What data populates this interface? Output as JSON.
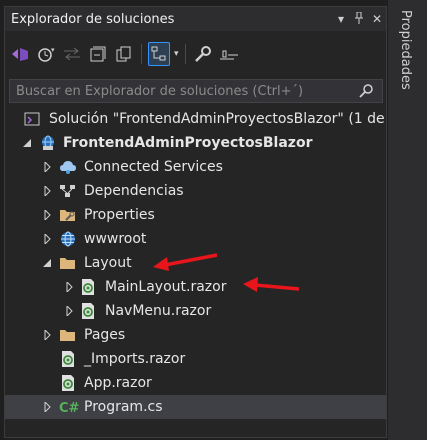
{
  "window": {
    "title": "Explorador de soluciones",
    "side_tab": "Propiedades"
  },
  "search": {
    "placeholder": "Buscar en Explorador de soluciones (Ctrl+´)"
  },
  "tree": {
    "solution": "Solución \"FrontendAdminProyectosBlazor\"  (1 de 1",
    "project": "FrontendAdminProyectosBlazor",
    "items": [
      {
        "label": "Connected Services",
        "icon": "connected-services-icon"
      },
      {
        "label": "Dependencias",
        "icon": "dependencies-icon"
      },
      {
        "label": "Properties",
        "icon": "properties-folder-icon"
      },
      {
        "label": "wwwroot",
        "icon": "globe-icon"
      },
      {
        "label": "Layout",
        "icon": "folder-icon"
      },
      {
        "label": "MainLayout.razor",
        "icon": "razor-file-icon"
      },
      {
        "label": "NavMenu.razor",
        "icon": "razor-file-icon"
      },
      {
        "label": "Pages",
        "icon": "folder-icon"
      },
      {
        "label": "_Imports.razor",
        "icon": "razor-file-icon"
      },
      {
        "label": "App.razor",
        "icon": "razor-file-icon"
      },
      {
        "label": "Program.cs",
        "icon": "csharp-file-icon"
      }
    ]
  },
  "colors": {
    "background": "#252526",
    "selection": "#3f3f46",
    "accent": "#3794ff",
    "annotation_arrow": "#e8151b",
    "folder": "#dcb67a"
  }
}
